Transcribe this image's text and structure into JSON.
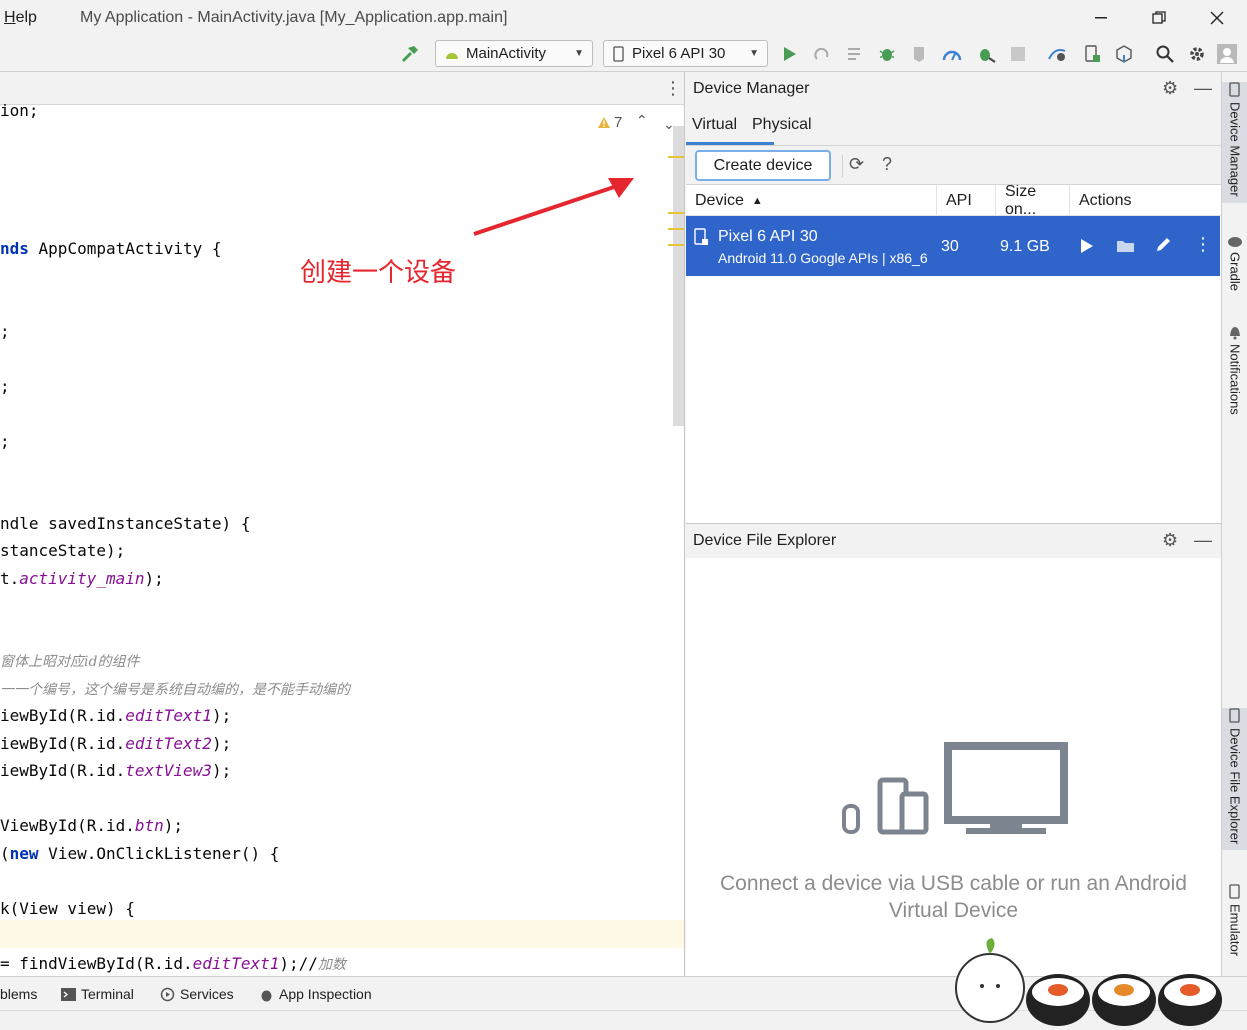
{
  "titlebar": {
    "menu_help": "Help",
    "title": "My Application - MainActivity.java [My_Application.app.main]"
  },
  "toolbar": {
    "run_config": "MainActivity",
    "device_select": "Pixel 6 API 30"
  },
  "editor": {
    "warnings_count": "7",
    "lines": {
      "l1": "ion;",
      "l2a": "nds",
      "l2b": " AppCompatActivity {",
      "l3": ";",
      "l4": ";",
      "l5": ";",
      "l6": "ndle savedInstanceState) {",
      "l7": "stanceState);",
      "l8a": "t.",
      "l8b": "activity_main",
      "l8c": ");",
      "c1": "窗体上昭对应id的组件",
      "c2": "一一个编号，这个编号是系统自动编的，是不能手动编的",
      "l9a": "iewById(R.id.",
      "l9b": "editText1",
      "l9c": ");",
      "l10a": "iewById(R.id.",
      "l10b": "editText2",
      "l10c": ");",
      "l11a": "iewById(R.id.",
      "l11b": "textView3",
      "l11c": ");",
      "l12a": "ViewById(R.id.",
      "l12b": "btn",
      "l12c": ");",
      "l13a": "(",
      "l13b": "new",
      "l13c": " View.OnClickListener() {",
      "l14": "k(View view) {",
      "l15a": "= findViewById(R.id.",
      "l15b": "editText1",
      "l15c": ");//",
      "l15d": "加数"
    }
  },
  "annotation": {
    "text": "创建一个设备",
    "color": "#e6262f"
  },
  "device_manager": {
    "title": "Device Manager",
    "tabs": [
      "Virtual",
      "Physical"
    ],
    "create_button": "Create device",
    "help": "?",
    "columns": [
      "Device",
      "API",
      "Size on...",
      "Actions"
    ],
    "row": {
      "name": "Pixel 6 API 30",
      "subtitle": "Android 11.0 Google APIs | x86_6",
      "api": "30",
      "size": "9.1 GB"
    }
  },
  "device_file_explorer": {
    "title": "Device File Explorer",
    "message_line1": "Connect a device via USB cable or run an Android",
    "message_line2": "Virtual Device"
  },
  "right_stripe": {
    "device_manager": "Device Manager",
    "gradle": "Gradle",
    "notifications": "Notifications",
    "device_file_explorer": "Device File Explorer",
    "emulator": "Emulator"
  },
  "bottom_bar": {
    "problems": "blems",
    "terminal": "Terminal",
    "services": "Services",
    "app_inspection": "App Inspection"
  },
  "colors": {
    "accent": "#2f65ca",
    "run_green": "#499c54"
  }
}
